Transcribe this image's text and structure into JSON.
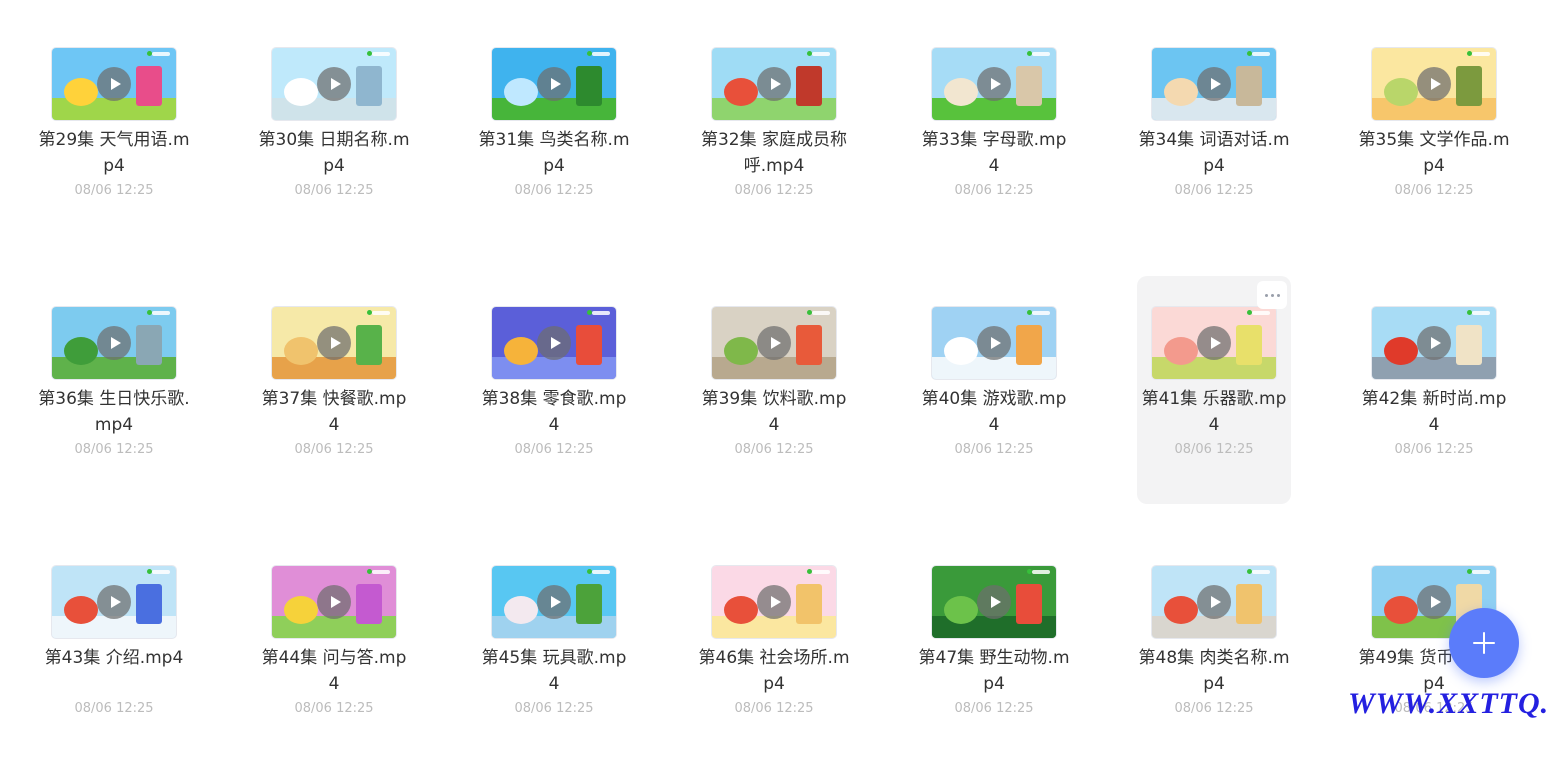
{
  "files": [
    {
      "name": "第29集 天气用语.mp4",
      "date": "08/06 12:25",
      "theme": {
        "sky": "#6ec6f5",
        "ground": "#9fd64a",
        "d1": "#ffd23a",
        "d2": "#e84d8a"
      }
    },
    {
      "name": "第30集 日期名称.mp4",
      "date": "08/06 12:25",
      "theme": {
        "sky": "#bfe9fb",
        "ground": "#cfe3ea",
        "d1": "#ffffff",
        "d2": "#8fb6cf"
      }
    },
    {
      "name": "第31集 鸟类名称.mp4",
      "date": "08/06 12:25",
      "theme": {
        "sky": "#3fb3ee",
        "ground": "#47b53a",
        "d1": "#bfe8ff",
        "d2": "#2d8a2e"
      }
    },
    {
      "name": "第32集 家庭成员称呼.mp4",
      "date": "08/06 12:25",
      "theme": {
        "sky": "#9fdcf5",
        "ground": "#8fd46e",
        "d1": "#e8503a",
        "d2": "#c0392b"
      }
    },
    {
      "name": "第33集 字母歌.mp4",
      "date": "08/06 12:25",
      "theme": {
        "sky": "#a6dcf6",
        "ground": "#58c23c",
        "d1": "#f2e6d0",
        "d2": "#d9c7a9"
      }
    },
    {
      "name": "第34集 词语对话.mp4",
      "date": "08/06 12:25",
      "theme": {
        "sky": "#6cc5f2",
        "ground": "#d9e7ef",
        "d1": "#f4d9b0",
        "d2": "#c8b89a"
      }
    },
    {
      "name": "第35集 文学作品.mp4",
      "date": "08/06 12:25",
      "theme": {
        "sky": "#fbe7a0",
        "ground": "#f7c66b",
        "d1": "#b9d66a",
        "d2": "#7c9a3e"
      }
    },
    {
      "name": "第36集 生日快乐歌.mp4",
      "date": "08/06 12:25",
      "theme": {
        "sky": "#7dcbef",
        "ground": "#5fb24b",
        "d1": "#3f9d3a",
        "d2": "#8aa7b4"
      }
    },
    {
      "name": "第37集 快餐歌.mp4",
      "date": "08/06 12:25",
      "theme": {
        "sky": "#f6e9a8",
        "ground": "#e7a24a",
        "d1": "#f0c36d",
        "d2": "#58b24a"
      }
    },
    {
      "name": "第38集 零食歌.mp4",
      "date": "08/06 12:25",
      "theme": {
        "sky": "#5b5fd9",
        "ground": "#7d8ef0",
        "d1": "#f6b33a",
        "d2": "#e84d3a"
      }
    },
    {
      "name": "第39集 饮料歌.mp4",
      "date": "08/06 12:25",
      "theme": {
        "sky": "#d9d2c4",
        "ground": "#b8a98f",
        "d1": "#7fb84a",
        "d2": "#e85a3a"
      }
    },
    {
      "name": "第40集 游戏歌.mp4",
      "date": "08/06 12:25",
      "theme": {
        "sky": "#9fd2f3",
        "ground": "#eef6fb",
        "d1": "#ffffff",
        "d2": "#f1a64a"
      }
    },
    {
      "name": "第41集 乐器歌.mp4",
      "date": "08/06 12:25",
      "theme": {
        "sky": "#fbd9d6",
        "ground": "#c7d86a",
        "d1": "#f39a8d",
        "d2": "#e8e06a"
      }
    },
    {
      "name": "第42集 新时尚.mp4",
      "date": "08/06 12:25",
      "theme": {
        "sky": "#a8dcf5",
        "ground": "#8fa0b0",
        "d1": "#e03a2a",
        "d2": "#f0e3c6"
      }
    },
    {
      "name": "第43集 介绍.mp4",
      "date": "08/06 12:25",
      "theme": {
        "sky": "#bfe4f7",
        "ground": "#eef6fb",
        "d1": "#e8503a",
        "d2": "#4a6fe0"
      }
    },
    {
      "name": "第44集 问与答.mp4",
      "date": "08/06 12:25",
      "theme": {
        "sky": "#e08ed7",
        "ground": "#8fcf5a",
        "d1": "#f6d23a",
        "d2": "#c45ad0"
      }
    },
    {
      "name": "第45集 玩具歌.mp4",
      "date": "08/06 12:25",
      "theme": {
        "sky": "#58c7f2",
        "ground": "#9fd2ef",
        "d1": "#f3e9ef",
        "d2": "#4ca23a"
      }
    },
    {
      "name": "第46集 社会场所.mp4",
      "date": "08/06 12:25",
      "theme": {
        "sky": "#fbd9e6",
        "ground": "#fbe7a0",
        "d1": "#e8503a",
        "d2": "#f2c36a"
      }
    },
    {
      "name": "第47集 野生动物.mp4",
      "date": "08/06 12:25",
      "theme": {
        "sky": "#3a9a3a",
        "ground": "#1f6e2a",
        "d1": "#6cc24a",
        "d2": "#e84d3a"
      }
    },
    {
      "name": "第48集 肉类名称.mp4",
      "date": "08/06 12:25",
      "theme": {
        "sky": "#bfe4f7",
        "ground": "#d9d6cf",
        "d1": "#e8503a",
        "d2": "#f0c36d"
      }
    },
    {
      "name": "第49集 货币名称.mp4",
      "date": "08/06 12:25",
      "theme": {
        "sky": "#8fd0f2",
        "ground": "#7fc24a",
        "d1": "#e8503a",
        "d2": "#f0d9a6"
      }
    }
  ],
  "hover_index": 12,
  "watermark": "WWW.XXTTQ.COM",
  "colors": {
    "accent": "#5b7cfa",
    "title": "#333333",
    "date": "#bcbcbc",
    "hover_bg": "#f3f3f4"
  }
}
